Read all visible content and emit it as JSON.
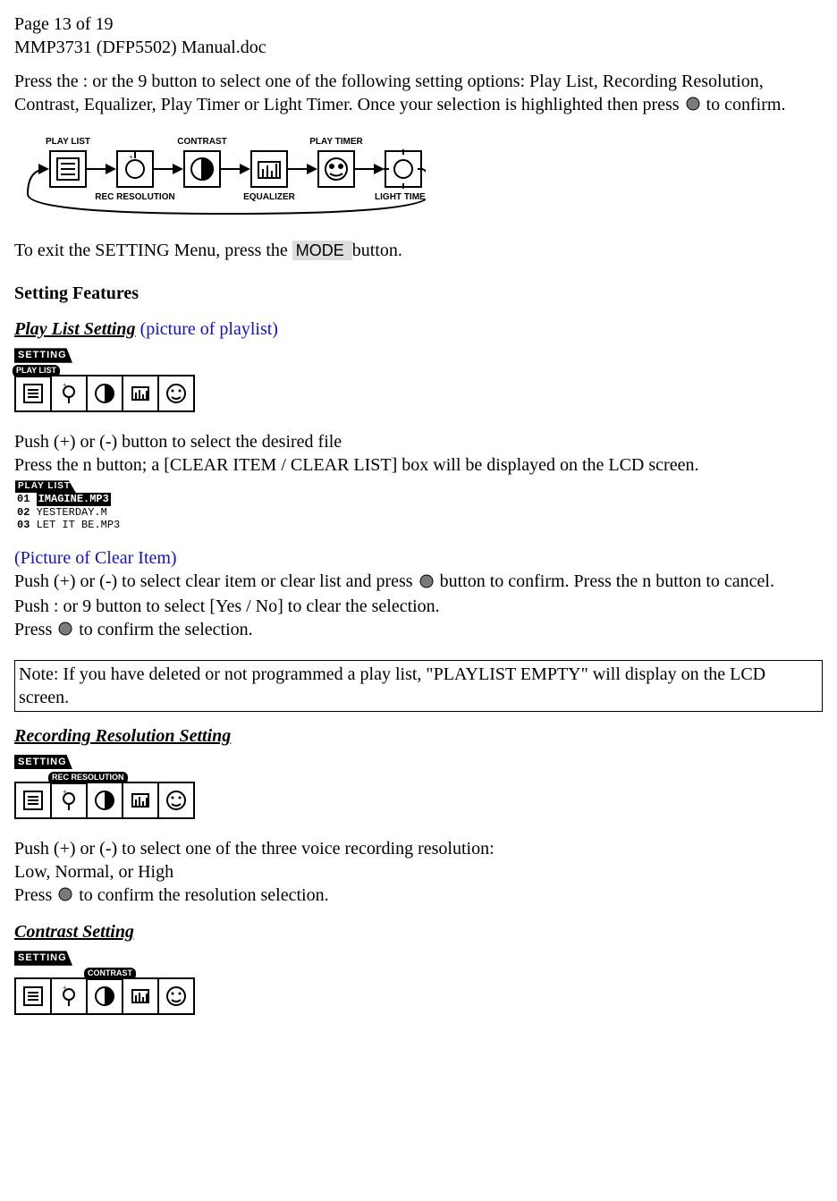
{
  "header": {
    "page_info": "Page 13 of 19",
    "doc_name": "MMP3731 (DFP5502) Manual.doc"
  },
  "intro": {
    "press_the": "Press the  ",
    "nav_left": ":",
    "or_the": "  or the ",
    "nav_right": "9",
    "text_1": "  button to select one of the following setting options:  Play List, Recording Resolution, Contrast, Equalizer, Play Timer or Light Timer.  Once your selection is highlighted then press ",
    "to_confirm": " to confirm."
  },
  "flow": {
    "items": [
      "PLAY LIST",
      "REC RESOLUTION",
      "CONTRAST",
      "EQUALIZER",
      "PLAY TIMER",
      "LIGHT TIMER"
    ]
  },
  "exit": {
    "pre": "To exit the SETTING Menu, press the ",
    "mode": " MODE ",
    "post": " button."
  },
  "h_setting_features": "Setting Features",
  "playlist": {
    "heading": "Play List Setting",
    "note": "  (picture of playlist)",
    "lcd_tab": "SETTING",
    "badge": "PLAY LIST",
    "line1": "Push (+) or (-) button to select the desired file",
    "line2_pre": "Press the ",
    "line2_btn": "n",
    "line2_post": " button; a [CLEAR ITEM / CLEAR LIST] box will be displayed on the LCD screen.",
    "files_tab": "PLAY LIST",
    "file_rows": [
      {
        "num": "01",
        "name": "IMAGINE.MP3",
        "selected": true
      },
      {
        "num": "02",
        "name": "YESTERDAY.M",
        "selected": false
      },
      {
        "num": "03",
        "name": "LET IT BE.MP3",
        "selected": false
      }
    ]
  },
  "clear": {
    "pic": "(Picture of Clear Item)",
    "l1_pre": "Push (+) or (-) to select clear item or clear list and press ",
    "l1_post": " button to confirm.  Press the ",
    "l1_btn": "n",
    "l1_end": " button to cancel.",
    "l2_pre": "Push ",
    "l2_a": ":",
    "l2_mid": "  or ",
    "l2_b": "9",
    "l2_post": "  button to select [Yes / No] to clear the selection.",
    "l3_pre": "Press ",
    "l3_post": " to confirm the selection."
  },
  "note_box": "Note: If you have deleted or not programmed a play list, \"PLAYLIST EMPTY\" will display on the LCD screen.",
  "rec": {
    "heading": "Recording Resolution Setting",
    "lcd_tab": "SETTING",
    "badge": "REC RESOLUTION",
    "l1": "Push (+) or (-) to select one of the three voice recording resolution:",
    "l2": "Low, Normal, or High",
    "l3_pre": "Press ",
    "l3_post": " to confirm the resolution selection."
  },
  "contrast": {
    "heading": "Contrast Setting",
    "lcd_tab": "SETTING",
    "badge": "CONTRAST"
  }
}
